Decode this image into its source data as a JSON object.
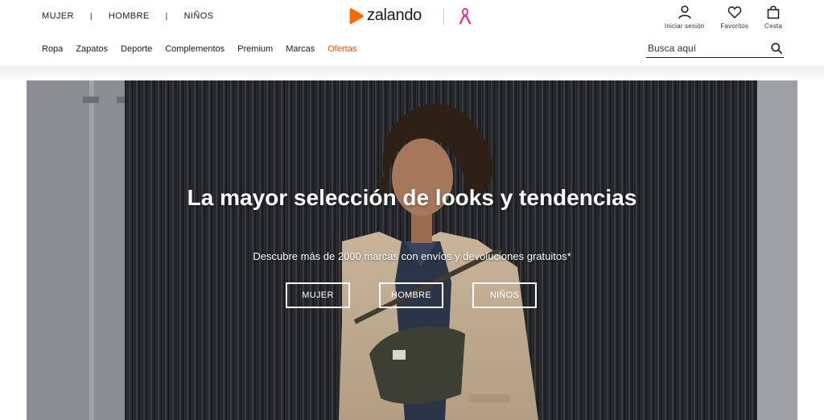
{
  "brand": {
    "name": "zalando",
    "accent": "#ff6900",
    "ribbon_color": "#e8358c"
  },
  "gender_nav": [
    {
      "label": "MUJER"
    },
    {
      "label": "HOMBRE"
    },
    {
      "label": "NIÑOS"
    }
  ],
  "gender_separator": "|",
  "category_nav": [
    {
      "label": "Ropa"
    },
    {
      "label": "Zapatos"
    },
    {
      "label": "Deporte"
    },
    {
      "label": "Complementos"
    },
    {
      "label": "Premium"
    },
    {
      "label": "Marcas"
    },
    {
      "label": "Ofertas",
      "color": "#ff4a00"
    }
  ],
  "actions": {
    "login": {
      "label": "Iniciar sesión",
      "icon": "user-icon"
    },
    "favorites": {
      "label": "Favoritos",
      "icon": "heart-icon"
    },
    "cart": {
      "label": "Cesta",
      "icon": "bag-icon"
    }
  },
  "search": {
    "placeholder": "Busca aquí",
    "icon": "search-icon"
  },
  "hero": {
    "title": "La mayor selección de looks y tendencias",
    "subtitle": "Descubre más de 2000 marcas con envíos y devoluciones gratuitos*",
    "buttons": [
      {
        "label": "MUJER"
      },
      {
        "label": "HOMBRE"
      },
      {
        "label": "NIÑOS"
      }
    ]
  }
}
